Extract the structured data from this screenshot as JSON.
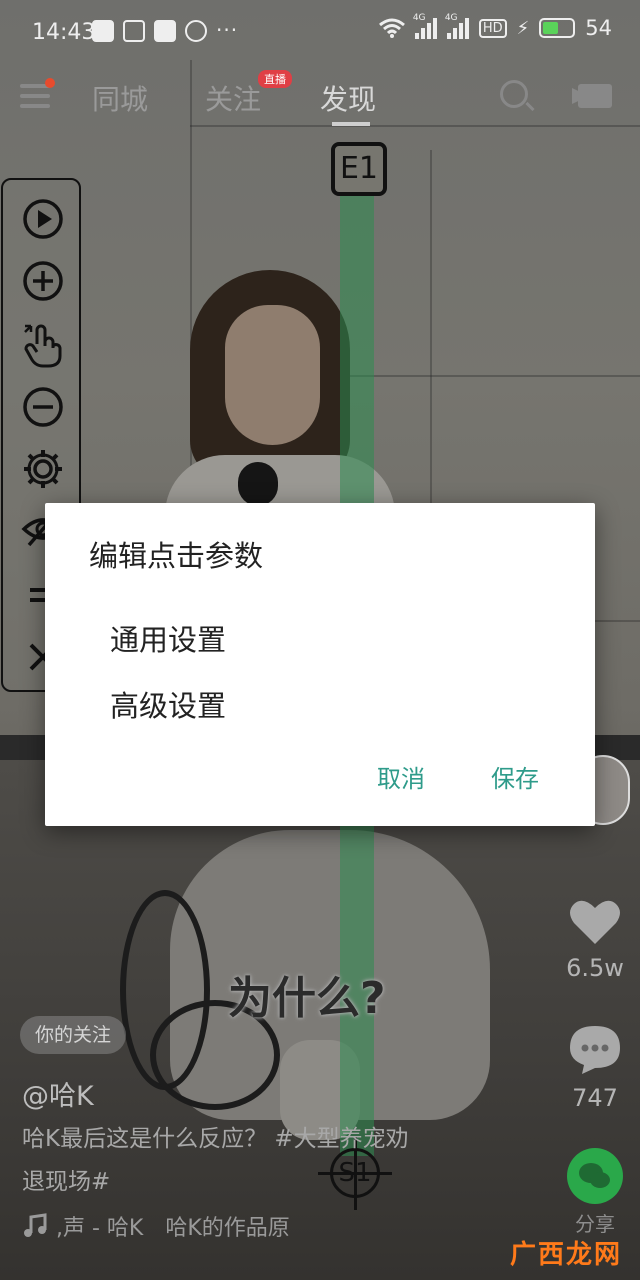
{
  "statusbar": {
    "time": "14:43",
    "left_icons": [
      "notification-icon",
      "hash-icon",
      "mail-icon",
      "paw-icon"
    ],
    "more": "···",
    "network_1": "4G",
    "network_2": "4G",
    "hd": "HD",
    "battery_percent": "54",
    "battery_level": 0.54,
    "battery_color": "#5ad25a"
  },
  "topnav": {
    "tabs": [
      "同城",
      "关注",
      "发现"
    ],
    "active_tab": "发现",
    "live_badge": "直播"
  },
  "overlay": {
    "end_marker": "E1",
    "start_marker": "S1",
    "path_color": "#2e8c50"
  },
  "toolpanel": {
    "tools": [
      "play-icon",
      "zoom-in-icon",
      "tap-gesture-icon",
      "zoom-out-icon",
      "settings-icon",
      "hide-icon",
      "equals-icon",
      "close-icon"
    ]
  },
  "side": {
    "likes": "6.5w",
    "comments": "747",
    "share": "分享"
  },
  "caption": {
    "follow_chip": "你的关注",
    "author": "@哈K",
    "description_line1": "哈K最后这是什么反应？ #大型养宠劝",
    "description_line2": "退现场#",
    "music": ",声 - 哈K　哈K的作品原",
    "subtitle": "为什么?"
  },
  "dialog": {
    "title": "编辑点击参数",
    "item_general": "通用设置",
    "item_advanced": "高级设置",
    "cancel": "取消",
    "save": "保存",
    "accent": "#2e9b8a"
  },
  "watermark": {
    "text": "广西龙网"
  }
}
